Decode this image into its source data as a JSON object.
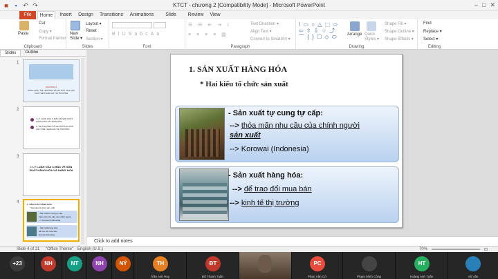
{
  "window": {
    "title": "KTCT - chương 2 [Compatibility Mode] - Microsoft PowerPoint"
  },
  "tabs": [
    "File",
    "Home",
    "Insert",
    "Design",
    "Transitions",
    "Animations",
    "Slide Show",
    "Review",
    "View"
  ],
  "ribbon": {
    "paste": "Paste",
    "cut": "Cut",
    "copy": "Copy ▾",
    "format_painter": "Format Painter",
    "clipboard": "Clipboard",
    "new_slide": "New Slide ▾",
    "layout": "Layout ▾",
    "reset": "Reset",
    "section": "Section ▾",
    "slides": "Slides",
    "font": "Font",
    "text_direction": "Text Direction ▾",
    "align_text": "Align Text ▾",
    "convert_smartart": "Convert to SmartArt ▾",
    "paragraph": "Paragraph",
    "arrange": "Arrange",
    "quick_styles": "Quick Styles ▾",
    "shape_fill": "Shape Fill ▾",
    "shape_outline": "Shape Outline ▾",
    "shape_effects": "Shape Effects ▾",
    "drawing": "Drawing",
    "find": "Find",
    "replace": "Replace ▾",
    "select": "Select ▾",
    "editing": "Editing"
  },
  "panel": {
    "tab_slides": "Slides",
    "tab_outline": "Outline",
    "thumbs": [
      {
        "num": "1",
        "heading": "CHƯƠNG 2",
        "text": "HÀNG HÓA, THỊ TRƯỜNG VÀ VAI TRÒ CỦA CÁC CHỦ THỂ THAM GIA THỊ TRƯỜNG"
      },
      {
        "num": "2",
        "bullet1": "I. LÝ LUẬN CỦA C.MÁC VỀ SẢN XUẤT HÀNG HÓA VÀ HÀNG HÓA",
        "bullet2": "II. THỊ TRƯỜNG VÀ VAI TRÒ CỦA CÁC CHỦ THỂ THAM GIA THỊ TRƯỜNG"
      },
      {
        "num": "3",
        "text": "I. LÝ LUẬN CỦA C.MÁC VỀ SẢN XUẤT HÀNG HÓA VÀ HÀNG HÓA"
      },
      {
        "num": "4"
      }
    ]
  },
  "slide": {
    "title": "1. SẢN XUẤT HÀNG HÓA",
    "subtitle": "* Hai kiểu tổ chức sản xuất",
    "box1": {
      "line1": "- Sản xuất tự cung tự cấp:",
      "line2_prefix": " --> ",
      "line2": "thỏa mãn nhu cầu của chính người",
      "line3": "sản xuất",
      "line4": "--> Korowai (Indonesia)"
    },
    "box2": {
      "line1": "- Sản xuất hàng hóa:",
      "line2_prefix": " --> ",
      "line2": "để trao đổi mua bán",
      "line3_prefix": "--> ",
      "line3": "kinh tế thị trường"
    }
  },
  "notes": {
    "placeholder": "Click to add notes"
  },
  "status": {
    "slide": "Slide 4 of 21",
    "theme": "\"Office Theme\"",
    "lang": "English (U.S.)",
    "zoom": "70%"
  },
  "participants": [
    {
      "initials": "+23",
      "name": "",
      "color": "#3b3b3b"
    },
    {
      "initials": "NH",
      "name": "",
      "color": "#c0392b"
    },
    {
      "initials": "NT",
      "name": "",
      "color": "#16a085"
    },
    {
      "initials": "NH",
      "name": "",
      "color": "#8e44ad"
    },
    {
      "initials": "NÝ",
      "name": "",
      "color": "#d35400"
    },
    {
      "initials": "TH",
      "name": "Trần Anh Huy",
      "color": "#e67e22"
    },
    {
      "initials": "ĐT",
      "name": "Đỗ Thanh Tuấn",
      "color": "#c0392b"
    },
    {
      "initials": "",
      "name": "",
      "color": "#6d5a4a"
    },
    {
      "initials": "PC",
      "name": "Phan Văn Cớ",
      "color": "#e74c3c"
    },
    {
      "initials": "",
      "name": "Phạm Minh Công",
      "color": "#444"
    },
    {
      "initials": "HT",
      "name": "Hoàng Anh Tuấn",
      "color": "#27ae60"
    },
    {
      "initials": "",
      "name": "Vũ Văn",
      "color": "#2980b9"
    }
  ],
  "colors": {
    "file_tab": "#d24726",
    "accent": "#f0b000",
    "box_top": "#eef4fc",
    "box_bottom": "#b9d1f0"
  }
}
